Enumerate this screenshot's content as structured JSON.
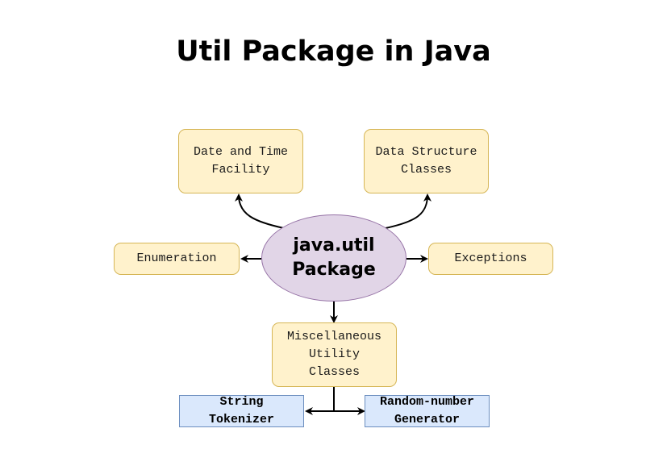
{
  "title": "Util Package in Java",
  "center": {
    "label": "java.util\nPackage"
  },
  "nodes": {
    "date_time": "Date and Time\nFacility",
    "data_structure": "Data Structure\nClasses",
    "enumeration": "Enumeration",
    "exceptions": "Exceptions",
    "misc": "Miscellaneous\nUtility\nClasses",
    "string_tokenizer": "String\nTokenizer",
    "random_generator": "Random-number\nGenerator"
  },
  "colors": {
    "center_fill": "#e1d5e7",
    "center_stroke": "#9673a6",
    "node_fill": "#fff2cc",
    "node_stroke": "#d6b656",
    "leaf_fill": "#dae8fc",
    "leaf_stroke": "#6c8ebf"
  }
}
